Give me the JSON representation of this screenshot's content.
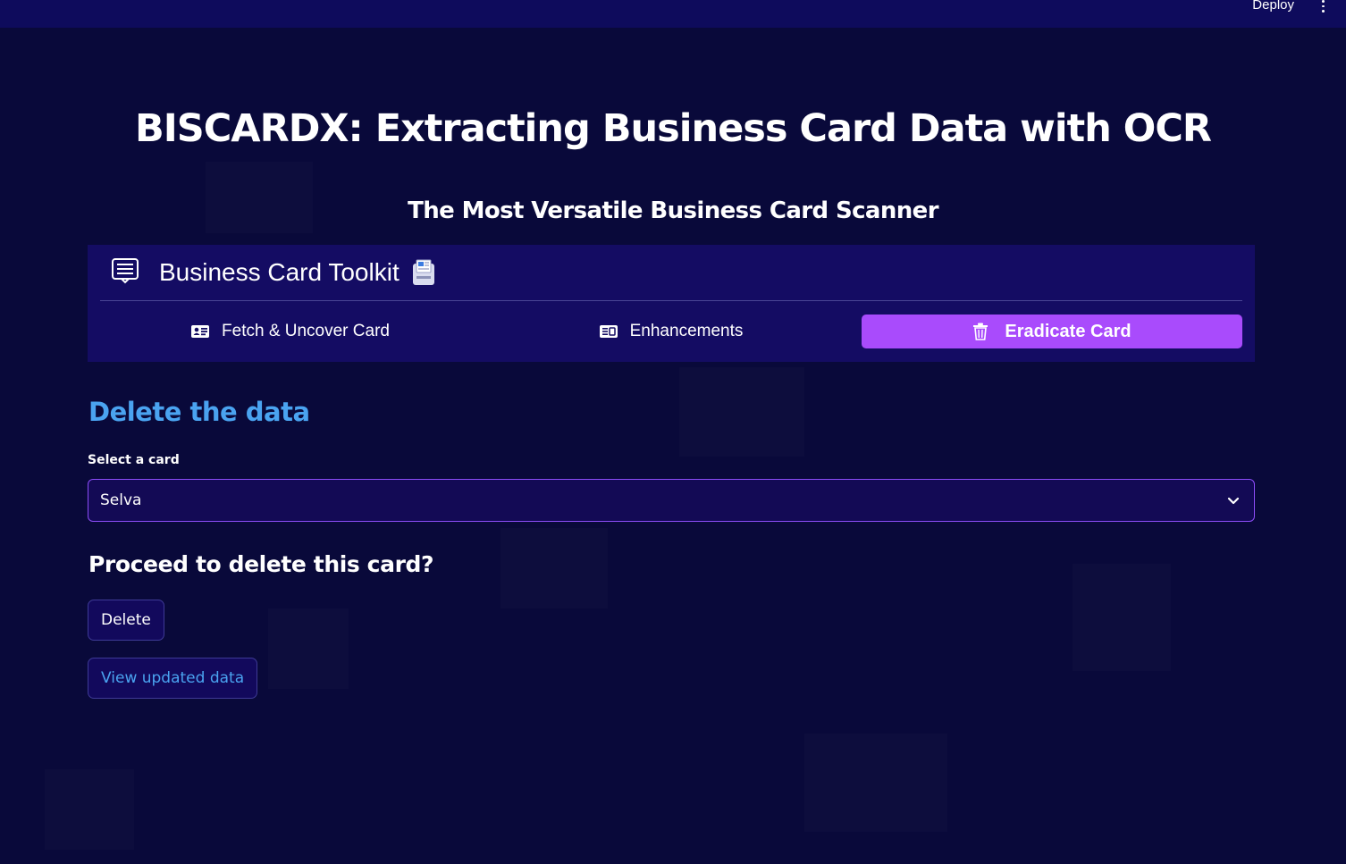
{
  "header": {
    "deploy_label": "Deploy",
    "menu_icon": "kebab-menu-icon"
  },
  "page": {
    "title": "BISCARDX: Extracting Business Card Data with OCR",
    "subtitle": "The Most Versatile Business Card Scanner"
  },
  "menu": {
    "title": "Business Card Toolkit",
    "title_icon": "list-icon",
    "title_emoji_icon": "card-index-icon",
    "items": [
      {
        "label": "Fetch & Uncover Card",
        "icon": "id-card-icon",
        "active": false
      },
      {
        "label": "Enhancements",
        "icon": "card-text-icon",
        "active": false
      },
      {
        "label": "Eradicate Card",
        "icon": "trash-icon",
        "active": true
      }
    ],
    "active_color": "#a94bfc"
  },
  "delete_section": {
    "heading": "Delete the data",
    "select_label": "Select a card",
    "selected_value": "Selva",
    "question": "Proceed to delete this card?",
    "delete_button": "Delete",
    "view_button": "View updated data"
  },
  "colors": {
    "background": "#09093a",
    "topbar": "#0e0b5c",
    "heading_blue": "#4aa3f0",
    "select_border": "#8b4cf6"
  }
}
